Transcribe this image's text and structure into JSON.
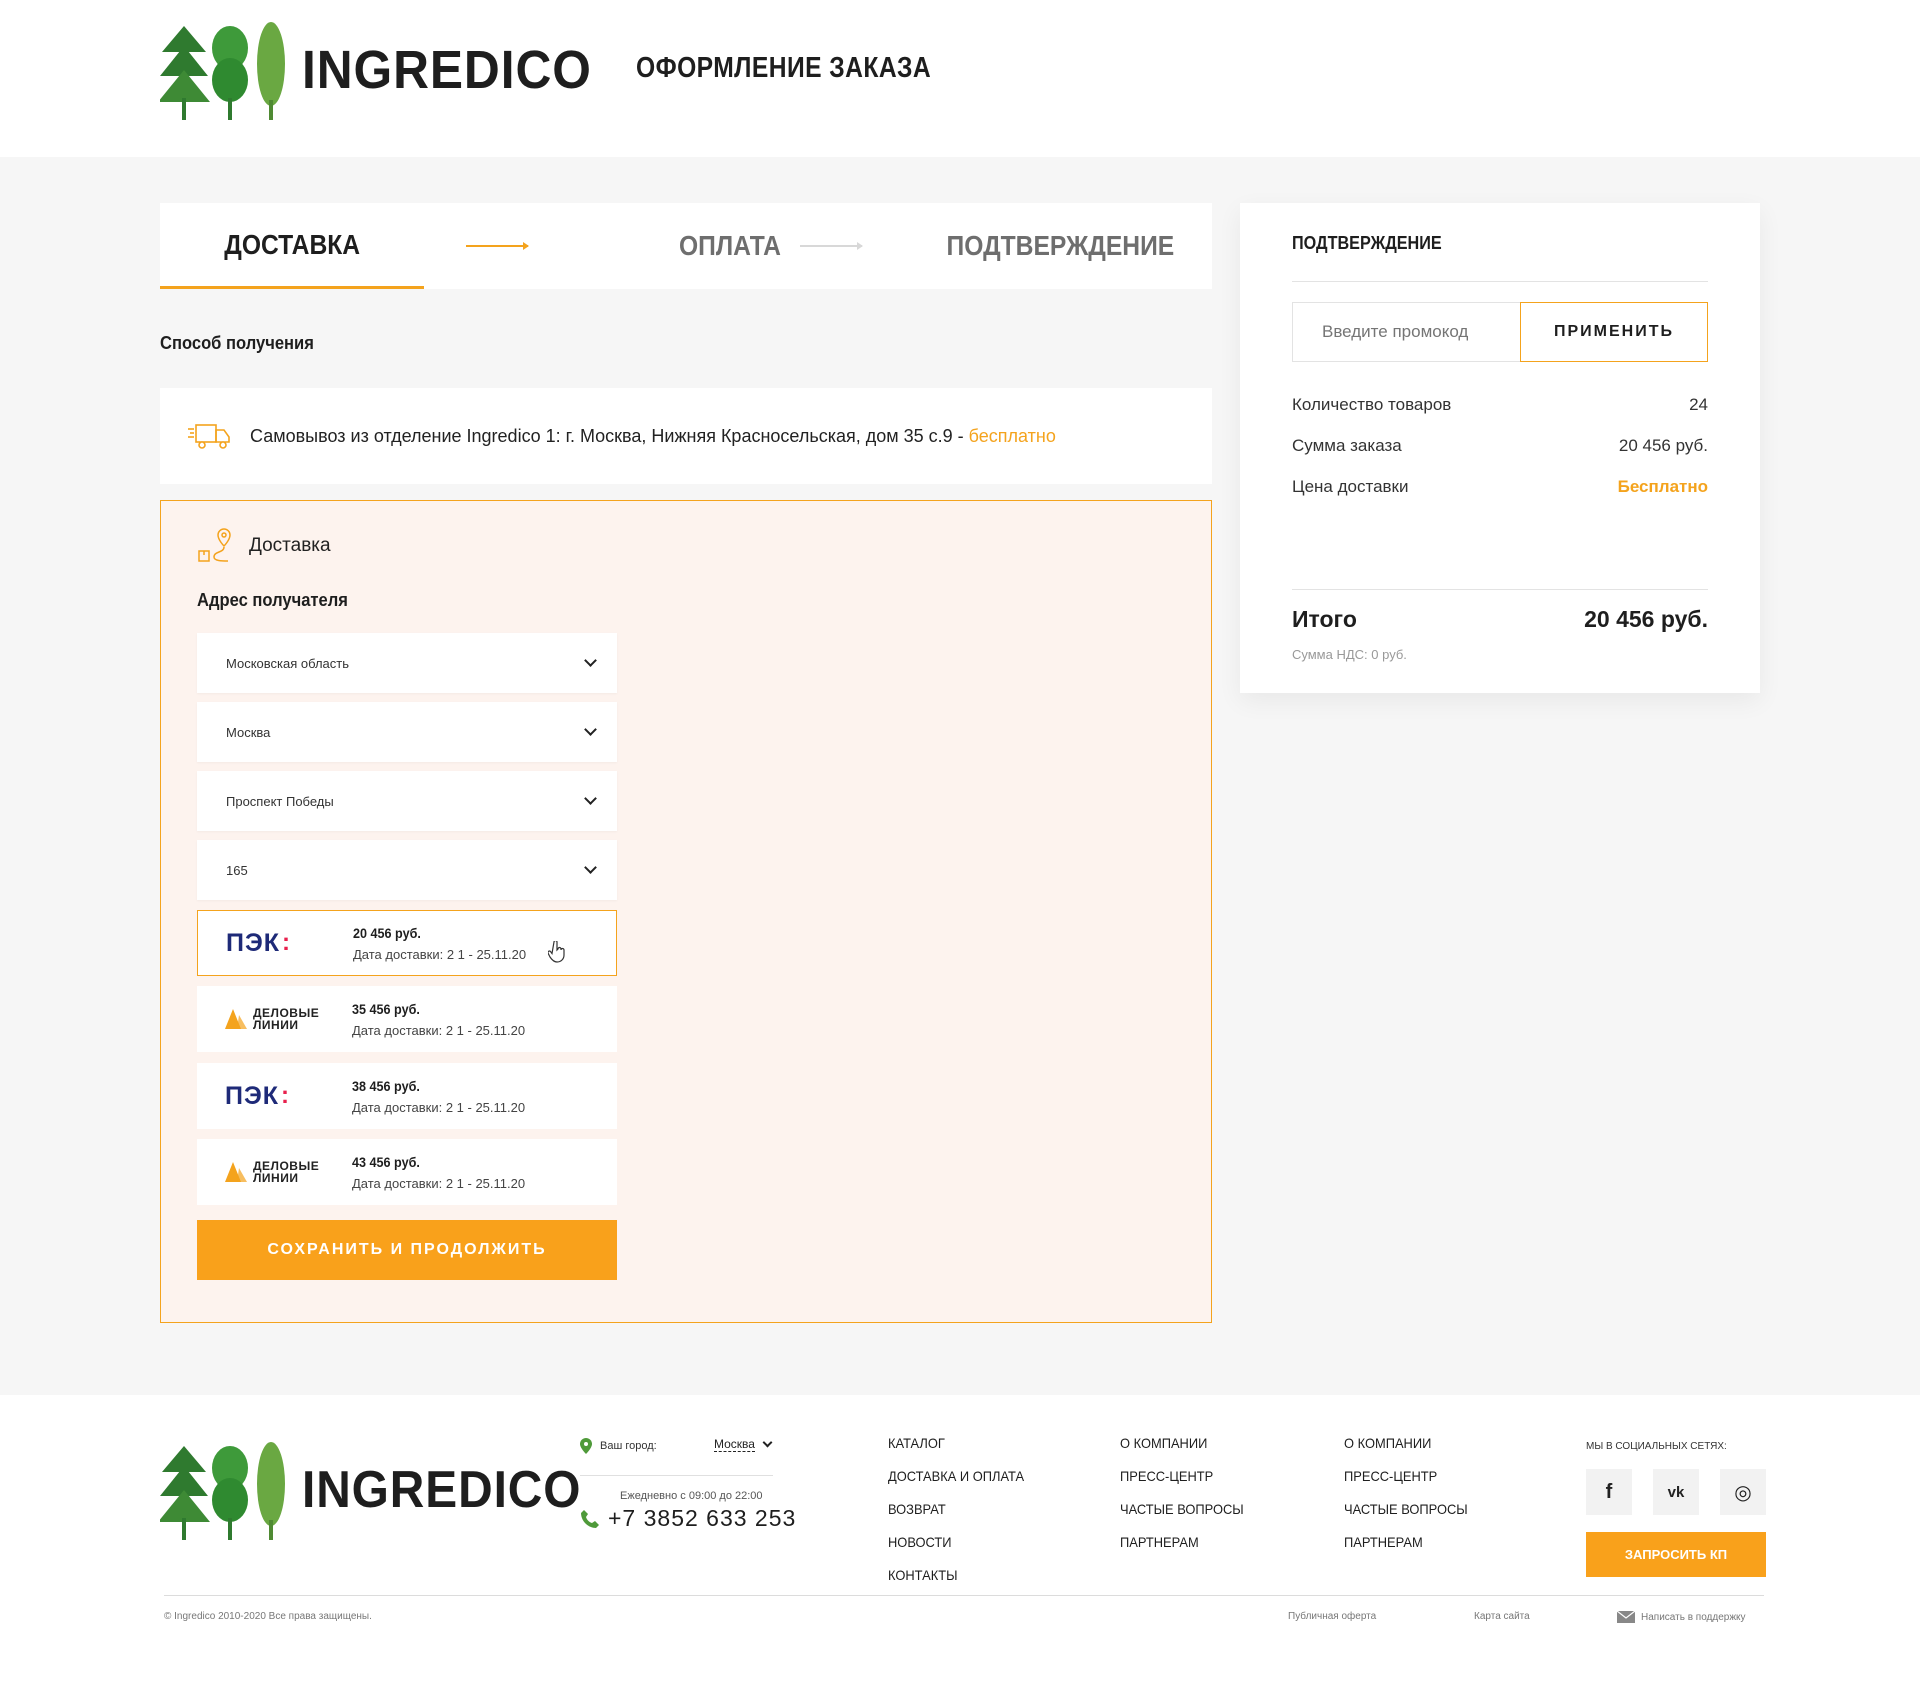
{
  "header": {
    "brand": "INGREDICO",
    "page_title": "ОФОРМЛЕНИЕ ЗАКАЗА"
  },
  "steps": [
    {
      "label": "ДОСТАВКА",
      "state": "active"
    },
    {
      "label": "ОПЛАТА",
      "state": "inactive"
    },
    {
      "label": "ПОДТВЕРЖДЕНИЕ",
      "state": "inactive"
    }
  ],
  "receipt": {
    "section_label": "Способ получения",
    "pickup_text": "Самовывоз из отделение Ingredico 1: г. Москва, Нижняя Красносельская, дом 35 с.9 -",
    "pickup_price": "бесплатно",
    "delivery_title": "Доставка",
    "address_label": "Адрес получателя",
    "selects": [
      "Московская область",
      "Москва",
      "Проспект Победы",
      "165"
    ],
    "carriers": [
      {
        "logo": "pek",
        "logo_text": "ПЭК",
        "price": "20 456 руб.",
        "date": "Дата доставки: 2 1 - 25.11.20",
        "selected": true
      },
      {
        "logo": "dellin",
        "logo_line1": "ДЕЛОВЫЕ",
        "logo_line2": "ЛИНИИ",
        "price": "35 456 руб.",
        "date": "Дата доставки: 2 1 - 25.11.20",
        "selected": false
      },
      {
        "logo": "pek",
        "logo_text": "ПЭК",
        "price": "38 456 руб.",
        "date": "Дата доставки: 2 1 - 25.11.20",
        "selected": false
      },
      {
        "logo": "dellin",
        "logo_line1": "ДЕЛОВЫЕ",
        "logo_line2": "ЛИНИИ",
        "price": "43 456 руб.",
        "date": "Дата доставки: 2 1 - 25.11.20",
        "selected": false
      }
    ],
    "save_button": "СОХРАНИТЬ И ПРОДОЛЖИТЬ"
  },
  "summary": {
    "title": "ПОДТВЕРЖДЕНИЕ",
    "promo_placeholder": "Введите промокод",
    "promo_button": "ПРИМЕНИТЬ",
    "rows": [
      {
        "label": "Количество товаров",
        "value": "24"
      },
      {
        "label": "Сумма заказа",
        "value": "20 456 руб."
      },
      {
        "label": "Цена доставки",
        "value": "Бесплатно"
      }
    ],
    "total_label": "Итого",
    "total_value": "20 456 руб.",
    "vat": "Сумма НДС: 0 руб."
  },
  "footer": {
    "brand": "INGREDICO",
    "city_label": "Ваш город:",
    "city_value": "Москва",
    "hours": "Ежедневно с 09:00 до 22:00",
    "phone": "+7 3852 633 253",
    "col1": [
      "КАТАЛОГ",
      "ДОСТАВКА И ОПЛАТА",
      "ВОЗВРАТ",
      "НОВОСТИ",
      "КОНТАКТЫ"
    ],
    "col2": [
      "О КОМПАНИИ",
      "ПРЕСС-ЦЕНТР",
      "ЧАСТЫЕ ВОПРОСЫ",
      "ПАРТНЕРАМ"
    ],
    "col3": [
      "О КОМПАНИИ",
      "ПРЕСС-ЦЕНТР",
      "ЧАСТЫЕ ВОПРОСЫ",
      "ПАРТНЕРАМ"
    ],
    "social_label": "МЫ В СОЦИАЛЬНЫХ СЕТЯХ:",
    "social": [
      {
        "icon": "facebook-icon",
        "glyph": "f"
      },
      {
        "icon": "vk-icon",
        "glyph": "vk"
      },
      {
        "icon": "instagram-icon",
        "glyph": "◎"
      }
    ],
    "kp_button": "ЗАПРОСИТЬ КП",
    "copyright": "© Ingredico 2010-2020 Все права защищены.",
    "offer_link": "Публичная оферта",
    "sitemap_link": "Карта сайта",
    "support_link": "Написать в поддержку"
  },
  "colors": {
    "accent": "#f4a31d",
    "button": "#f9a11b",
    "pek_blue": "#1e2a78",
    "pek_red": "#e8214d",
    "tree_dark": "#2f7a2f",
    "tree_light": "#6aa842"
  }
}
